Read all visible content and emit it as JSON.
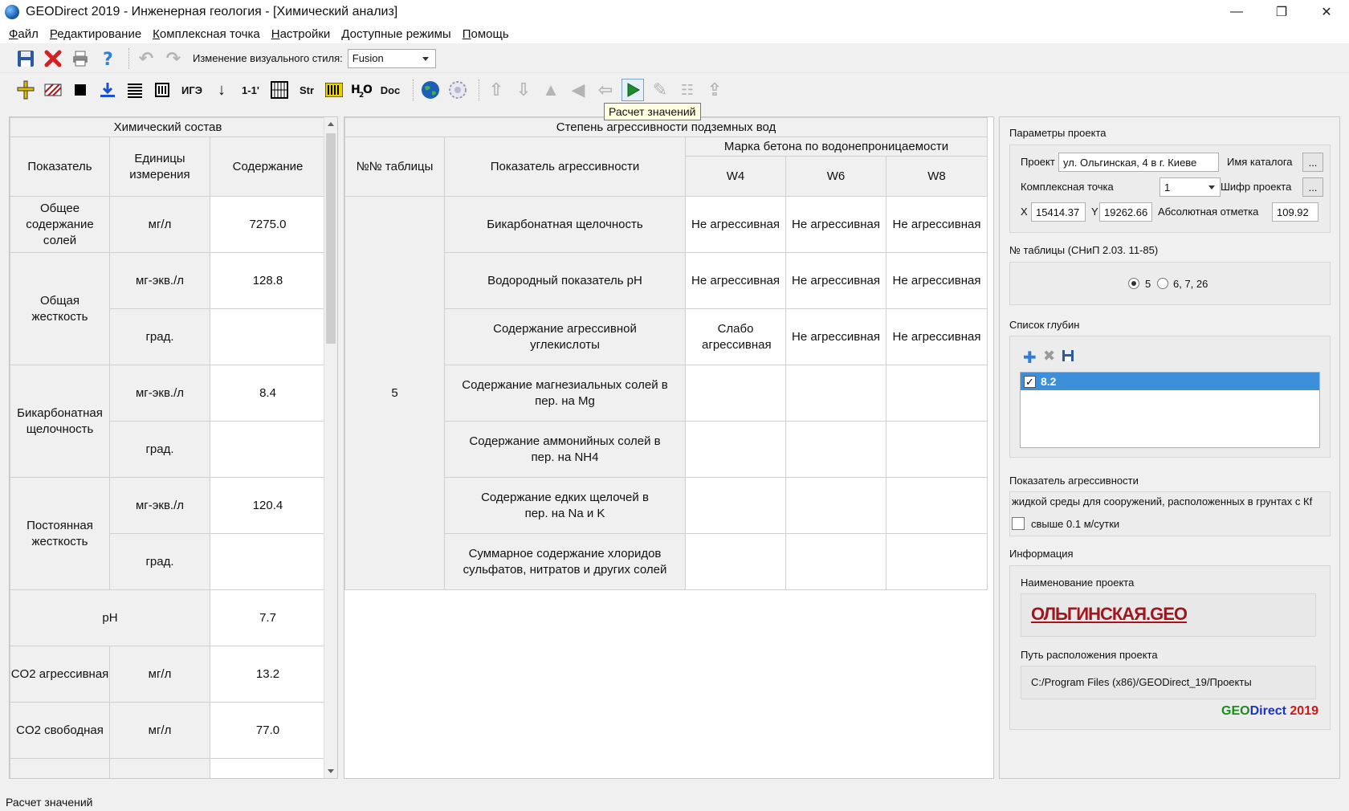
{
  "window": {
    "title": "GEODirect 2019 - Инженерная геология - [Химический анализ]"
  },
  "menu": [
    "Файл",
    "Редактирование",
    "Комплексная точка",
    "Настройки",
    "Доступные режимы",
    "Помощь"
  ],
  "toolbar": {
    "style_label": "Изменение визуального стиля:",
    "style_value": "Fusion",
    "btn_igz": "ИГЭ",
    "btn_section": "1-1'",
    "btn_str": "Str",
    "btn_doc": "Doc"
  },
  "tooltip": "Расчет значений",
  "chem": {
    "title": "Химический состав",
    "col_indicator": "Показатель",
    "col_units": "Единицы измерения",
    "col_content": "Содержание",
    "rows": [
      {
        "name": "Общее содержание солей",
        "units": "мг/л",
        "value": "7275.0"
      },
      {
        "name": "Общая жесткость",
        "units1": "мг-экв./л",
        "value1": "128.8",
        "units2": "град.",
        "value2": ""
      },
      {
        "name": "Бикарбонатная щелочность",
        "units1": "мг-экв./л",
        "value1": "8.4",
        "units2": "град.",
        "value2": ""
      },
      {
        "name": "Постоянная жесткость",
        "units1": "мг-экв./л",
        "value1": "120.4",
        "units2": "град.",
        "value2": ""
      },
      {
        "name": "pH",
        "value": "7.7"
      },
      {
        "name": "CO2 агрессивная",
        "units": "мг/л",
        "value": "13.2"
      },
      {
        "name": "CO2 свободная",
        "units": "мг/л",
        "value": "77.0"
      }
    ]
  },
  "aggr": {
    "title": "Степень агрессивности подземных вод",
    "col_table_no": "№№ таблицы",
    "col_indicator": "Показатель агрессивности",
    "col_grade": "Марка бетона по водонепроницаемости",
    "col_w4": "W4",
    "col_w6": "W6",
    "col_w8": "W8",
    "table_no": "5",
    "rows": [
      {
        "name": "Бикарбонатная щелочность",
        "w4": "Не агрессивная",
        "w6": "Не агрессивная",
        "w8": "Не агрессивная"
      },
      {
        "name": "Водородный показатель pH",
        "w4": "Не агрессивная",
        "w6": "Не агрессивная",
        "w8": "Не агрессивная"
      },
      {
        "name": "Содержание агрессивной углекислоты",
        "w4": "Слабо агрессивная",
        "w6": "Не агрессивная",
        "w8": "Не агрессивная"
      },
      {
        "name": "Содержание магнезиальных солей в пер. на Mg",
        "w4": "",
        "w6": "",
        "w8": ""
      },
      {
        "name": "Содержание аммонийных солей в пер. на NH4",
        "w4": "",
        "w6": "",
        "w8": ""
      },
      {
        "name": "Содержание едких щелочей в пер. на Na и K",
        "w4": "",
        "w6": "",
        "w8": ""
      },
      {
        "name": "Суммарное содержание хлоридов сульфатов, нитратов и других солей",
        "w4": "",
        "w6": "",
        "w8": ""
      }
    ]
  },
  "project": {
    "group_title": "Параметры проекта",
    "project_label": "Проект",
    "project_value": "ул. Ольгинская, 4 в г. Киеве",
    "catalog_label": "Имя каталога",
    "point_label": "Комплексная точка",
    "point_value": "1",
    "cipher_label": "Шифр проекта",
    "dots": "...",
    "x_label": "X",
    "x_value": "15414.37",
    "y_label": "Y",
    "y_value": "19262.66",
    "abs_label": "Абсолютная отметка",
    "abs_value": "109.92"
  },
  "snip": {
    "group_title": "№ таблицы (СНиП 2.03. 11-85)",
    "opt1": "5",
    "opt2": "6, 7, 26"
  },
  "depths": {
    "group_title": "Список глубин",
    "items": [
      "8.2"
    ]
  },
  "aggr_indicator": {
    "group_title": "Показатель агрессивности",
    "text": "жидкой среды для сооружений, расположенных в грунтах с Кf",
    "check_label": "свыше  0.1 м/сутки"
  },
  "info": {
    "group_title": "Информация",
    "name_label": "Наименование проекта",
    "name_value": "ОЛЬГИНСКАЯ.GEO",
    "path_label": "Путь расположения проекта",
    "path_value": "C:/Program Files (x86)/GEODirect_19/Проекты",
    "brand_geo": "GEO",
    "brand_direct": "Direct",
    "brand_year": "2019",
    "colors": {
      "geo": "#1c8a1c",
      "direct": "#1a34c8",
      "year": "#d01818"
    }
  },
  "status": "Расчет значений"
}
